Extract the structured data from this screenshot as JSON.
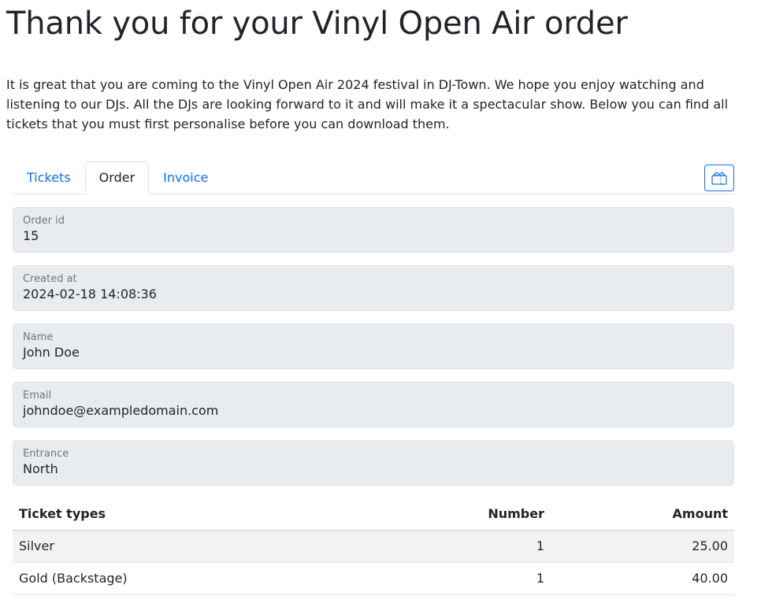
{
  "page": {
    "title": "Thank you for your Vinyl Open Air order",
    "intro": "It is great that you are coming to the Vinyl Open Air 2024 festival in DJ-Town. We hope you enjoy watching and listening to our DJs. All the DJs are looking forward to it and will make it a spectacular show. Below you can find all tickets that you must first personalise before you can download them."
  },
  "tabs": [
    {
      "label": "Tickets",
      "active": false
    },
    {
      "label": "Order",
      "active": true
    },
    {
      "label": "Invoice",
      "active": false
    }
  ],
  "tab_action_icon": "ticket-icon",
  "accent_color": "#0d6efd",
  "order": {
    "fields": [
      {
        "label": "Order id",
        "value": "15"
      },
      {
        "label": "Created at",
        "value": "2024-02-18 14:08:36"
      },
      {
        "label": "Name",
        "value": "John Doe"
      },
      {
        "label": "Email",
        "value": "johndoe@exampledomain.com"
      },
      {
        "label": "Entrance",
        "value": "North"
      }
    ]
  },
  "ticket_table": {
    "headers": [
      "Ticket types",
      "Number",
      "Amount"
    ],
    "rows": [
      {
        "type": "Silver",
        "number": "1",
        "amount": "25.00"
      },
      {
        "type": "Gold (Backstage)",
        "number": "1",
        "amount": "40.00"
      }
    ]
  }
}
